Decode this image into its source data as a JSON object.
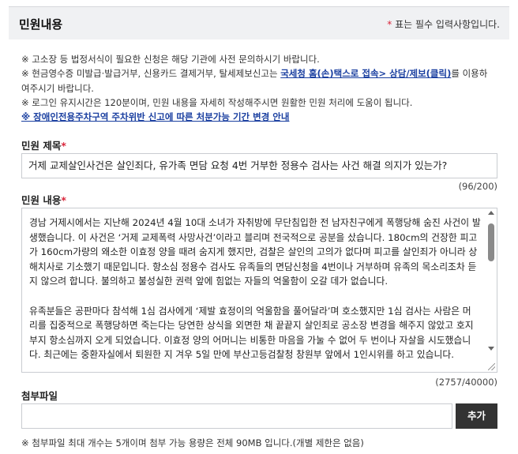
{
  "header": {
    "title": "민원내용",
    "required_mark": "*",
    "required_note": " 표는 필수 입력사항입니다."
  },
  "notice": {
    "line1": "※ 고소장 등 법정서식이 필요한 신청은 해당 기관에 사전 문의하시기 바랍니다.",
    "line2_pre": "※ 현금영수증 미발급·발급거부, 신용카드 결제거부, 탈세제보신고는 ",
    "line2_link": "국세청 홈(손)택스로 접속> 상담/제보(클릭)",
    "line2_post": "를 이용하",
    "line3": "여주시기 바랍니다.",
    "line4": "※ 로그인 유지시간은 120분이며, 민원 내용을 자세히 작성해주시면 원활한 민원 처리에 도움이 됩니다.",
    "line5_link": "※ 장애인전용주차구역 주차위반 신고에 따른 처분가능 기간 변경 안내"
  },
  "title_field": {
    "label": "민원 제목",
    "required_mark": "*",
    "value": "거제 교제살인사건은 살인죄다, 유가족 면담 요청 4번 거부한 정용수 검사는 사건 해결 의지가 있는가?",
    "counter": "(96/200)"
  },
  "content_field": {
    "label": "민원 내용",
    "required_mark": "*",
    "lines": [
      "경남 거제시에서는 지난해 2024년 4월 10대 소녀가 자취방에 무단침입한 전 남자친구에게 폭행당해 숨진 사건이 발",
      "생했습니다. 이 사건은 ‘거제 교제폭력 사망사건’이라고 블리며 전국적으로 공분을 샀습니다. 180cm의 건장한 피고",
      "가 160cm가량의 왜소한 이효정 양을 때려 숨지게 했지만, 검찰은 살인의 고의가 없다며 피고를 살인죄가 아니라 상",
      "해치사로 기소했기 때문입니다. 항소심 정용수 검사도 유족들의 면담신청을 4번이나 거부하며 유족의 목소리조차 듣",
      "지 않으려 합니다. 불의하고 불성실한 권력 앞에 힘없는 자들의 억울함이 오갈 데가 없습니다.",
      "",
      "유족분들은 공판마다 참석해 1심 검사에게 ‘제발 효정이의 억울함을 풀어달라’며 호소했지만 1심 검사는 사람은 머",
      "리를 집중적으로 폭행당하면 죽는다는 당연한 상식을 외면한 채 끝끝지 살인죄로 공소장 변경을 해주지 않았고 호지",
      "부지 항소심까지 오게 되었습니다. 이효정 양의 어머니는 비통한 마음을 가눌 수 없어 두 번이나 자살을 시도했습니",
      "다. 최근에는 중환자실에서 퇴원한 지 겨우 5일 만에 부산고등검찰청 창원부 앞에서 1인시위를 하고 있습니다."
    ],
    "counter": "(2757/40000)"
  },
  "attachment": {
    "label": "첨부파일",
    "add_label": "추가",
    "footnote": "※ 첨부파일 최대 개수는 5개이며 첨부 가능 용량은 전체 90MB 입니다.(개별 제한은 없음)"
  },
  "colors": {
    "required": "#d9263b",
    "link": "#1a3fa0",
    "header_bg": "#f0f1f3",
    "button_bg": "#333333"
  }
}
